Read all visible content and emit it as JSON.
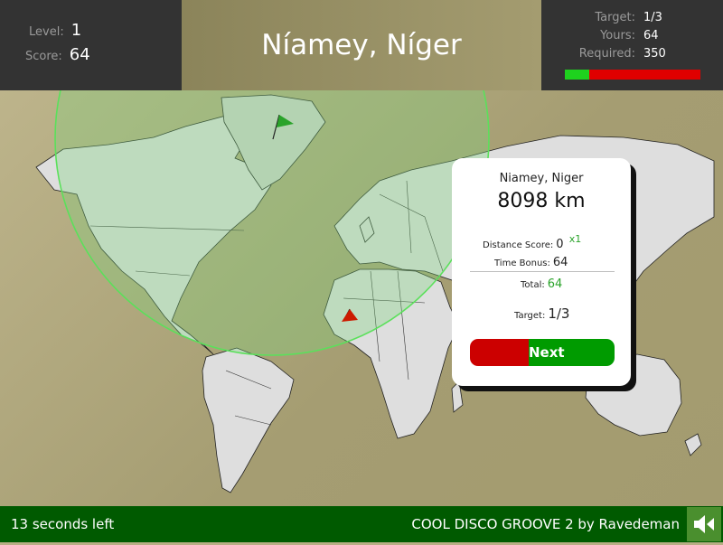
{
  "header": {
    "level_label": "Level:",
    "level_value": "1",
    "score_label": "Score:",
    "score_value": "64",
    "city_title": "Níamey, Níger",
    "target_label": "Target:",
    "target_value": "1/3",
    "yours_label": "Yours:",
    "yours_value": "64",
    "required_label": "Required:",
    "required_value": "350",
    "progress_fraction": 0.18
  },
  "result_card": {
    "city": "Niamey, Niger",
    "distance": "8098 km",
    "distance_score_label": "Distance Score:",
    "distance_score_value": "0",
    "multiplier": "x1",
    "time_bonus_label": "Time Bonus:",
    "time_bonus_value": "64",
    "total_label": "Total:",
    "total_value": "64",
    "target_label": "Target:",
    "target_value": "1/3",
    "next_label": "Next"
  },
  "footer": {
    "time_left": "13 seconds left",
    "music": "COOL DISCO GROOVE 2 by Ravedeman"
  },
  "colors": {
    "bar": "#333333",
    "footer": "#005a00",
    "green": "#2aa32a",
    "red": "#cc0000"
  },
  "icons": [
    "guess-flag-icon",
    "target-flag-icon",
    "speaker-icon"
  ]
}
